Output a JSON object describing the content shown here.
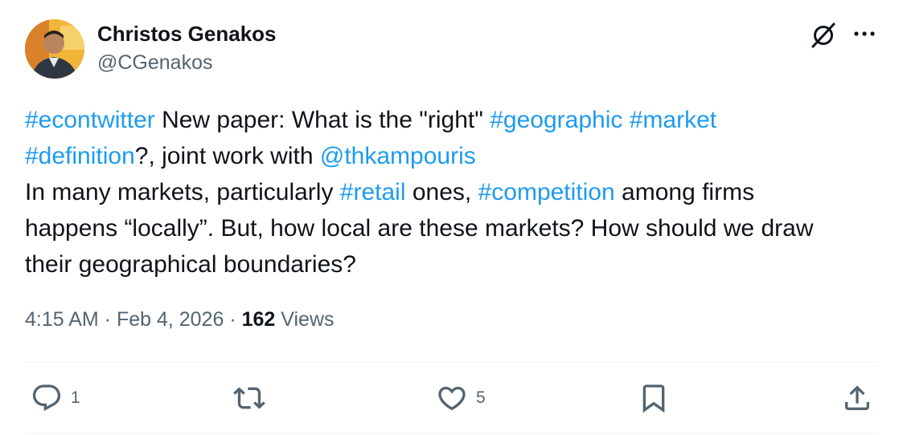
{
  "author": {
    "display_name": "Christos Genakos",
    "handle": "@CGenakos"
  },
  "tweet": {
    "line1": {
      "tag1": "#econtwitter",
      "text1": " New paper: What is the \"right\" ",
      "tag2": "#geographic",
      "text2": " ",
      "tag3": "#market"
    },
    "line2": {
      "tag1": "#definition",
      "text1": "?, joint work with ",
      "mention": "@thkampouris"
    },
    "line3": {
      "text1": "In many markets, particularly ",
      "tag1": "#retail",
      "text2": " ones, ",
      "tag2": "#competition",
      "text3": " among firms"
    },
    "line4": "happens “locally”. But, how local are these markets? How should we draw",
    "line5": "their geographical boundaries?"
  },
  "meta": {
    "time": "4:15 AM",
    "sep1": " · ",
    "date": "Feb 4, 2026",
    "sep2": " · ",
    "views_count": "162",
    "views_label": " Views"
  },
  "actions": {
    "reply_count": "1",
    "retweet_count": "",
    "like_count": "5"
  },
  "icons": {
    "reply": "reply-icon",
    "retweet": "retweet-icon",
    "like": "heart-icon",
    "bookmark": "bookmark-icon",
    "share": "share-icon",
    "grok": "grok-icon",
    "more": "more-icon"
  },
  "colors": {
    "link": "#1d9bf0",
    "secondary": "#536471",
    "text": "#0f1419"
  }
}
